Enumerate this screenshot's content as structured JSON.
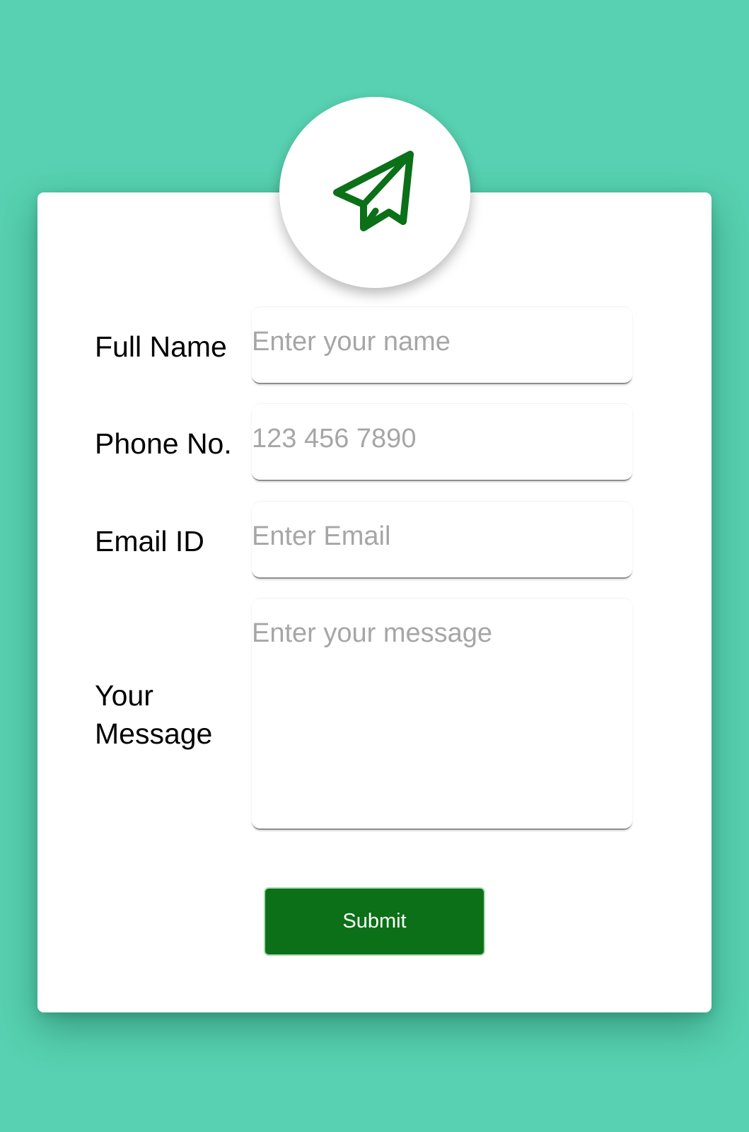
{
  "icons": {
    "header_icon": "paper-plane-icon"
  },
  "colors": {
    "background": "#57d1b1",
    "card": "#ffffff",
    "accent": "#0b7018",
    "placeholder": "#a6a6a6"
  },
  "form": {
    "full_name": {
      "label": "Full Name",
      "placeholder": "Enter your name",
      "value": ""
    },
    "phone": {
      "label": "Phone No.",
      "placeholder": "123 456 7890",
      "value": ""
    },
    "email": {
      "label": "Email ID",
      "placeholder": "Enter Email",
      "value": ""
    },
    "message": {
      "label": "Your Message",
      "placeholder": "Enter your message",
      "value": ""
    },
    "submit_label": "Submit"
  }
}
